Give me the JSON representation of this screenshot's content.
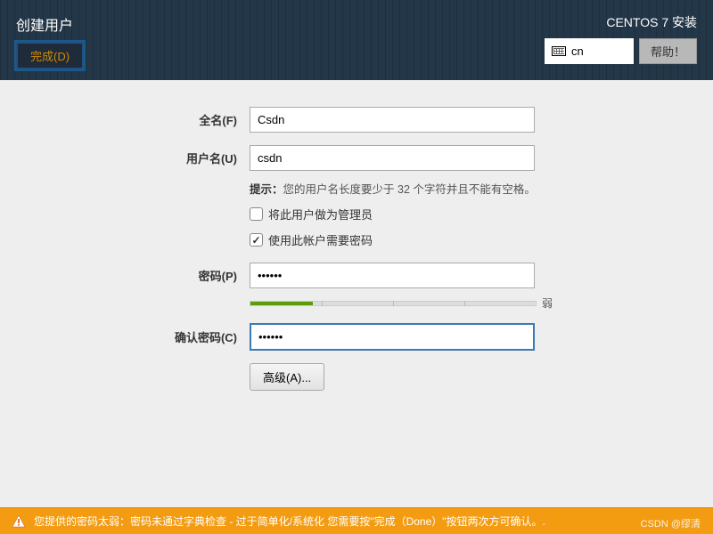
{
  "header": {
    "title": "创建用户",
    "done_label": "完成(D)",
    "installer_title": "CENTOS 7 安装",
    "lang": "cn",
    "help_label": "帮助！"
  },
  "form": {
    "fullname_label": "全名(F)",
    "fullname_value": "Csdn",
    "username_label": "用户名(U)",
    "username_value": "csdn",
    "hint_prefix": "提示：",
    "hint_text": "您的用户名长度要少于 32 个字符并且不能有空格。",
    "admin_checkbox": {
      "checked": false,
      "label": "将此用户做为管理员"
    },
    "require_pw_checkbox": {
      "checked": true,
      "label": "使用此帐户需要密码"
    },
    "password_label": "密码(P)",
    "password_value": "••••••",
    "strength_label": "弱",
    "confirm_label": "确认密码(C)",
    "confirm_value": "••••••",
    "advanced_label": "高级(A)..."
  },
  "warning": {
    "text": "您提供的密码太弱：密码未通过字典检查 - 过于简单化/系统化 您需要按\"完成（Done）\"按钮两次方可确认。."
  },
  "watermark": "CSDN @缪清"
}
